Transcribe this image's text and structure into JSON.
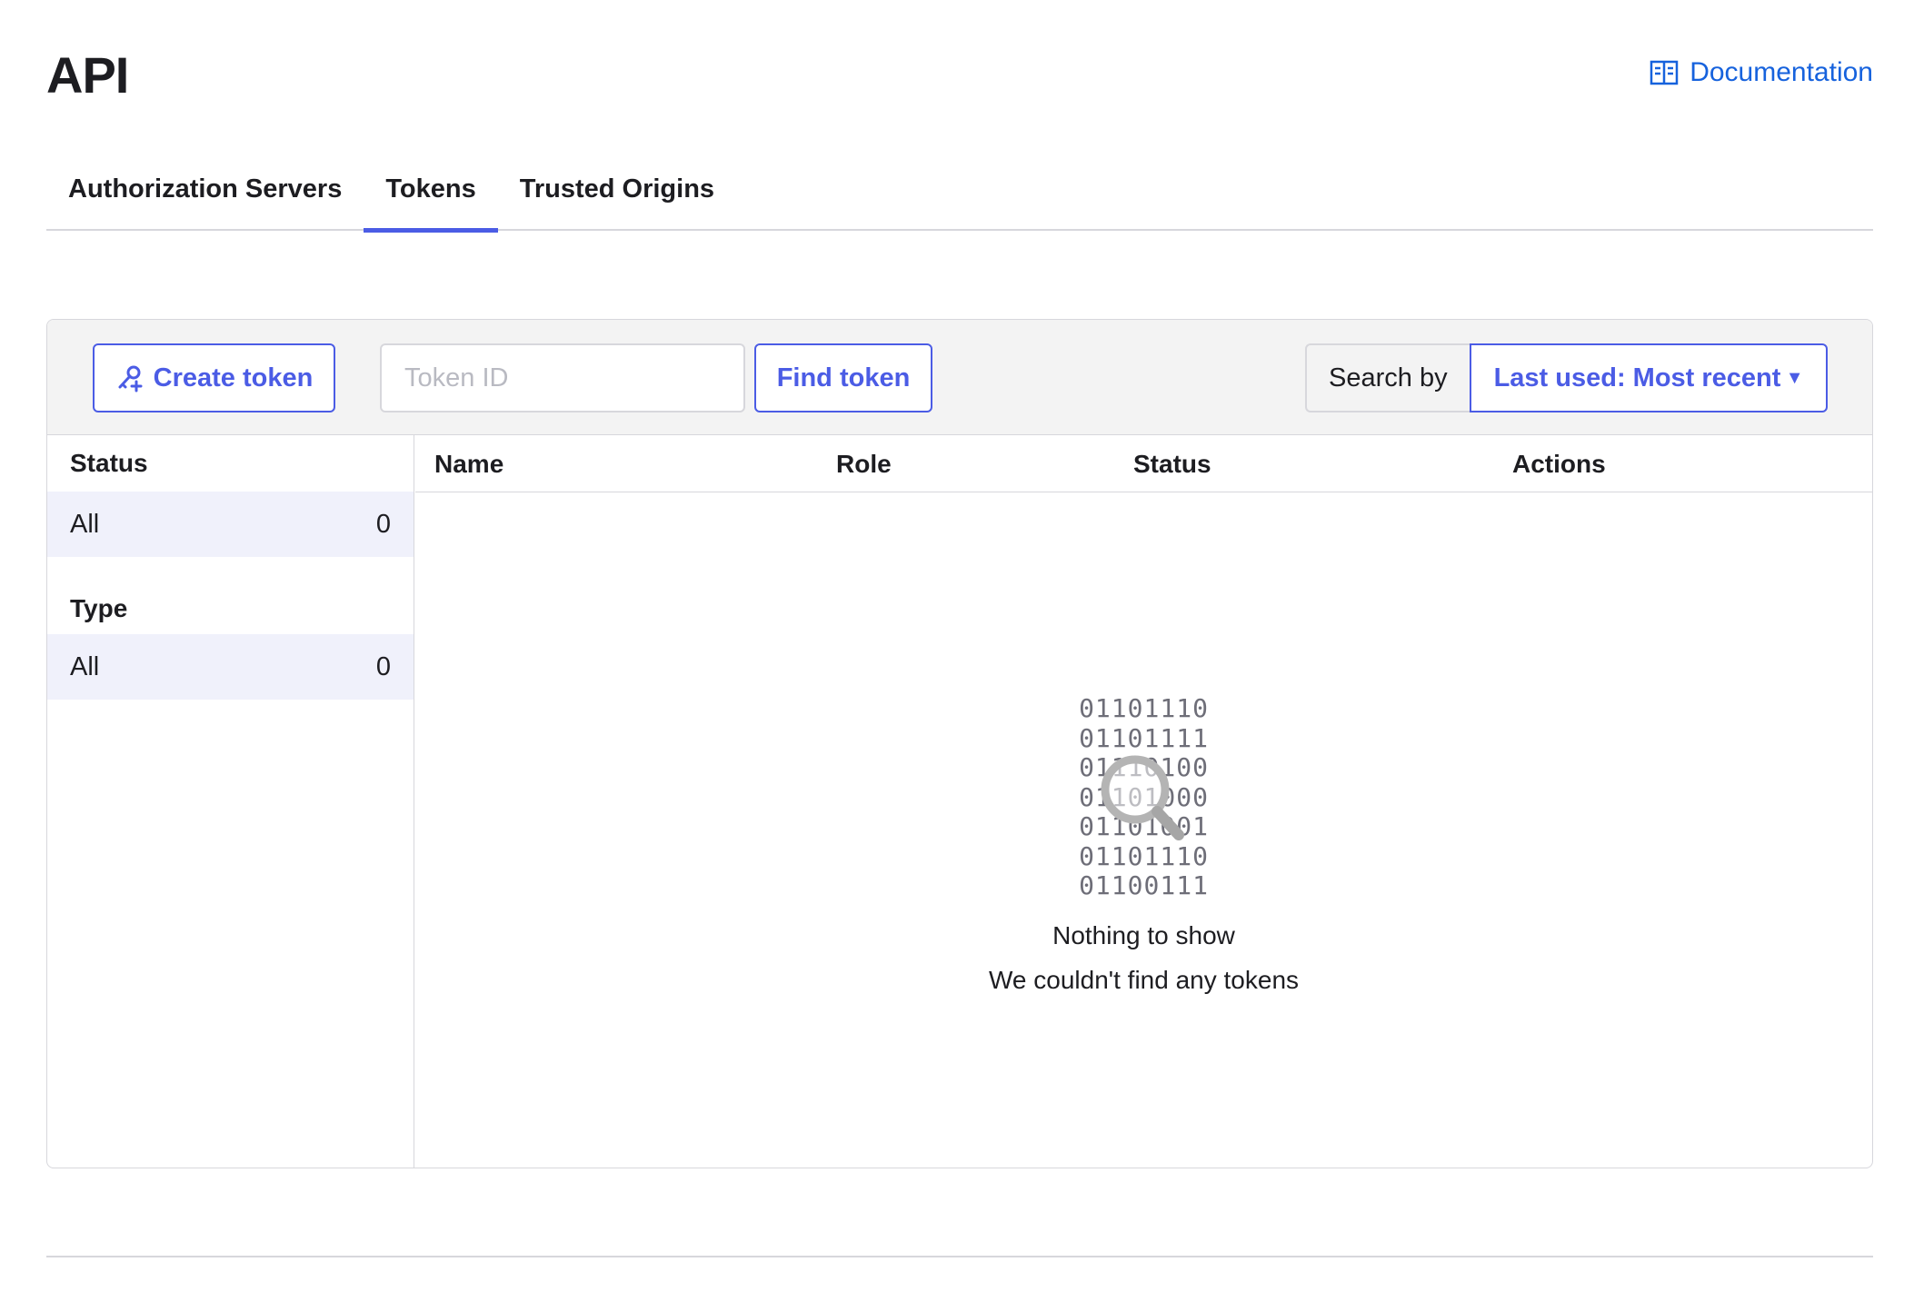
{
  "header": {
    "title": "API",
    "doc_link": "Documentation"
  },
  "tabs": [
    {
      "label": "Authorization Servers",
      "active": false
    },
    {
      "label": "Tokens",
      "active": true
    },
    {
      "label": "Trusted Origins",
      "active": false
    }
  ],
  "toolbar": {
    "create_label": "Create token",
    "token_placeholder": "Token ID",
    "token_value": "",
    "find_label": "Find token",
    "search_by_label": "Search by",
    "search_by_selected": "Last used: Most recent"
  },
  "sidebar": {
    "status_heading": "Status",
    "status_rows": [
      {
        "label": "All",
        "count": "0"
      }
    ],
    "type_heading": "Type",
    "type_rows": [
      {
        "label": "All",
        "count": "0"
      }
    ]
  },
  "table": {
    "columns": [
      "Name",
      "Role",
      "Status",
      "Actions"
    ],
    "rows": []
  },
  "empty_state": {
    "binary": [
      "01101110",
      "01101111",
      "01110100",
      "01101000",
      "01101001",
      "01101110",
      "01100111"
    ],
    "title": "Nothing to show",
    "subtitle": "We couldn't find any tokens"
  },
  "colors": {
    "accent": "#4b5ce5",
    "link": "#1662dd",
    "border": "#d7d7dc",
    "toolbar_bg": "#f3f3f3",
    "selected_row_bg": "#f0f1fb"
  },
  "icons": {
    "doc": "book-icon",
    "create": "key-plus-icon",
    "caret": "caret-down-icon",
    "empty": "magnifier-icon"
  }
}
